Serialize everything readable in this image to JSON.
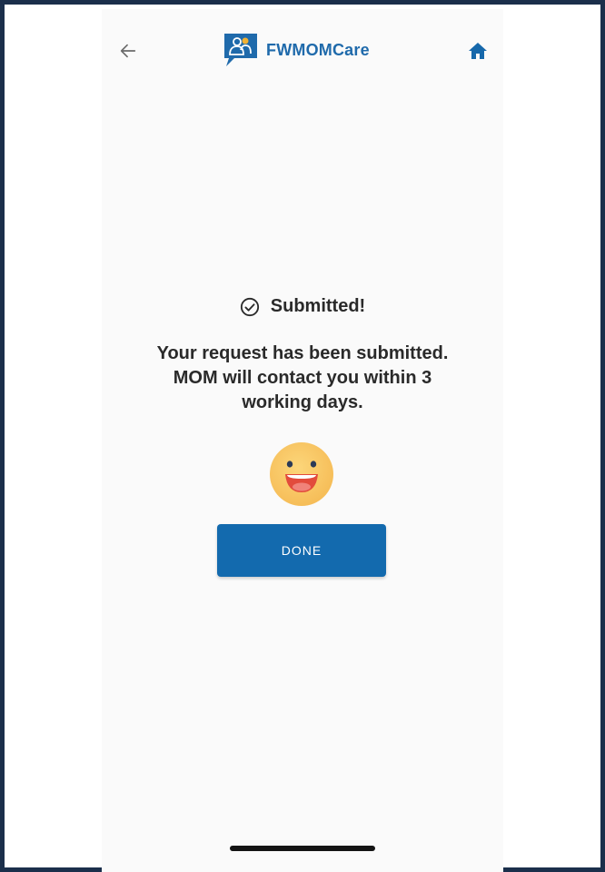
{
  "header": {
    "app_name": "FWMOMCare",
    "back_icon": "arrow-left-icon",
    "home_icon": "home-icon",
    "logo_icon": "chat-bubble-people-icon"
  },
  "status": {
    "title": "Submitted!",
    "icon": "check-circle-icon"
  },
  "message": {
    "line1": "Your request has been submitted.",
    "line2": "MOM will contact you within 3",
    "line3": "working days."
  },
  "emoji": {
    "icon": "grinning-face-icon"
  },
  "done_button": {
    "label": "DONE"
  },
  "colors": {
    "brand_blue": "#136aae",
    "logo_text": "#1f6aab",
    "frame": "#1b2f4b",
    "emoji_face": "#fbcf6b"
  }
}
